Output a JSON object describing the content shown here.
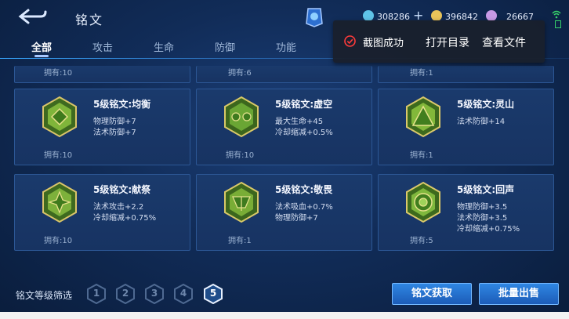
{
  "header": {
    "title": "铭文",
    "currencies": [
      {
        "icon": "coupon-icon",
        "value": "308286",
        "color": "#5fc3e8"
      },
      {
        "icon": "gold-coin-icon",
        "value": "396842",
        "color": "#e8c35a"
      },
      {
        "icon": "gem-icon",
        "value": "26667",
        "color": "#c79ae6"
      }
    ],
    "plus_label": "+"
  },
  "tabs": [
    {
      "label": "全部",
      "active": true
    },
    {
      "label": "攻击",
      "active": false
    },
    {
      "label": "生命",
      "active": false
    },
    {
      "label": "防御",
      "active": false
    },
    {
      "label": "功能",
      "active": false
    }
  ],
  "toast": {
    "message": "截图成功",
    "open_dir": "打开目录",
    "view_file": "查看文件"
  },
  "partial_row": [
    {
      "own": "拥有:10"
    },
    {
      "own": "拥有:6"
    },
    {
      "own": "拥有:1"
    }
  ],
  "cards": [
    {
      "name": "5级铭文:均衡",
      "attrs": [
        "物理防御+7",
        "法术防御+7"
      ],
      "own": "拥有:10",
      "gem": "gem-balance-icon",
      "color": "#7fb53a"
    },
    {
      "name": "5级铭文:虚空",
      "attrs": [
        "最大生命+45",
        "冷却缩减+0.5%"
      ],
      "own": "拥有:10",
      "gem": "gem-void-icon",
      "color": "#6aa634"
    },
    {
      "name": "5级铭文:灵山",
      "attrs": [
        "法术防御+14"
      ],
      "own": "拥有:1",
      "gem": "gem-mountain-icon",
      "color": "#82b83a"
    },
    {
      "name": "5级铭文:献祭",
      "attrs": [
        "法术攻击+2.2",
        "冷却缩减+0.75%"
      ],
      "own": "拥有:10",
      "gem": "gem-sacrifice-icon",
      "color": "#7db13b"
    },
    {
      "name": "5级铭文:敬畏",
      "attrs": [
        "法术吸血+0.7%",
        "物理防御+7"
      ],
      "own": "拥有:1",
      "gem": "gem-awe-icon",
      "color": "#79ad36"
    },
    {
      "name": "5级铭文:回声",
      "attrs": [
        "物理防御+3.5",
        "法术防御+3.5",
        "冷却缩减+0.75%"
      ],
      "own": "拥有:5",
      "gem": "gem-echo-icon",
      "color": "#7fb83d"
    }
  ],
  "bottom": {
    "filter_label": "铭文等级筛选",
    "levels": [
      "1",
      "2",
      "3",
      "4",
      "5"
    ],
    "active_level": "5",
    "obtain_button": "铭文获取",
    "sell_button": "批量出售"
  }
}
